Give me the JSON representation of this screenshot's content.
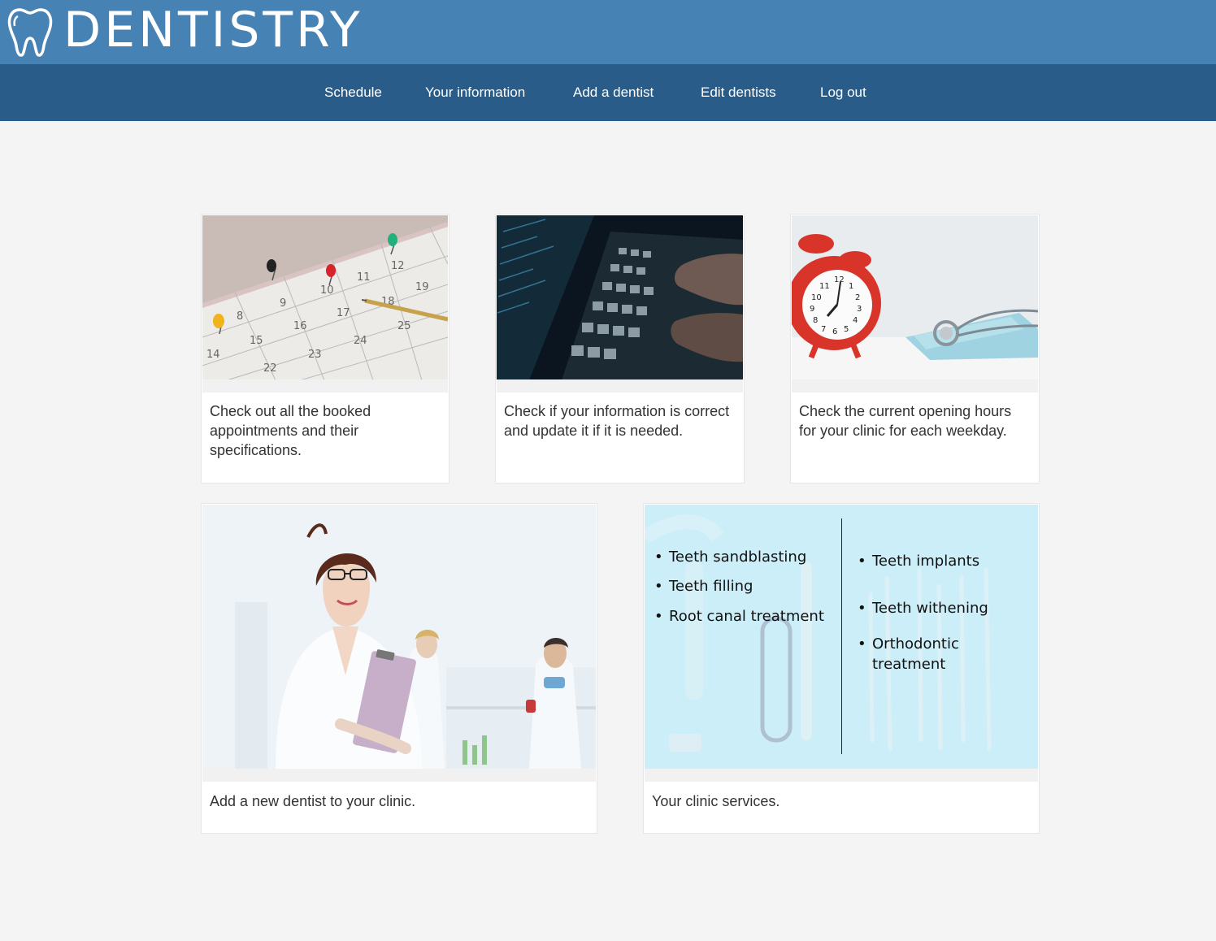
{
  "header": {
    "brand": "DENTISTRY",
    "logo_icon": "tooth-icon",
    "colors": {
      "brand_bar": "#4682b4",
      "nav_bar": "#2a5c8a",
      "page_bg": "#f4f4f4"
    }
  },
  "nav": {
    "items": [
      {
        "label": "Schedule"
      },
      {
        "label": "Your information"
      },
      {
        "label": "Add a dentist"
      },
      {
        "label": "Edit dentists"
      },
      {
        "label": "Log out"
      }
    ]
  },
  "cards": {
    "schedule": {
      "text": "Check out all the booked appointments and their specifications."
    },
    "information": {
      "text": "Check if your information is correct and update it if it is needed."
    },
    "hours": {
      "text": "Check the current opening hours for your clinic for each weekday."
    },
    "add_dentist": {
      "text": "Add a new dentist to your clinic."
    },
    "services": {
      "text": "Your clinic services.",
      "left_column": [
        "Teeth sandblasting",
        "Teeth filling",
        "Root canal treatment"
      ],
      "right_column": [
        "Teeth implants",
        "Teeth withening",
        "Orthodontic treatment"
      ]
    }
  }
}
